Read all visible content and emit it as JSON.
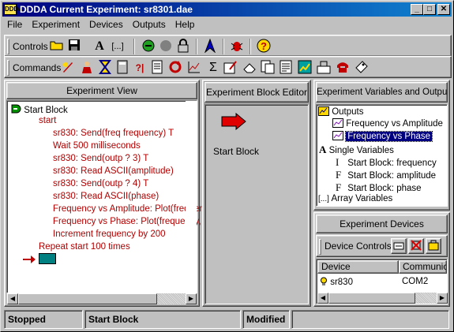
{
  "window": {
    "title": "DDDA Current Experiment: sr8301.dae",
    "app_icon": "DDDA",
    "minimize": "_",
    "maximize": "□",
    "close": "✕"
  },
  "menu": [
    "File",
    "Experiment",
    "Devices",
    "Outputs",
    "Help"
  ],
  "toolbar_controls": {
    "label": "Controls",
    "icons": [
      "open-folder-icon",
      "save-disk-icon",
      "font-a-icon",
      "ellipsis-brackets-icon",
      "green-run-icon",
      "gray-stop-icon",
      "lock-icon",
      "blue-arrow-icon",
      "bug-icon",
      "help-question-icon"
    ]
  },
  "toolbar_commands": {
    "label": "Commands",
    "icons": [
      "rocket-icon",
      "person-icon",
      "hourglass-icon",
      "calculator-icon",
      "conditional-icon",
      "file-icon",
      "loop-icon",
      "graph-icon",
      "sigma-icon",
      "write-icon",
      "eraser-icon",
      "report-icon",
      "document-icon",
      "chart-image-icon",
      "plot-icon",
      "phone-icon",
      "label-icon"
    ]
  },
  "experiment_view": {
    "header": "Experiment View",
    "lines": [
      {
        "text": "Start Block",
        "indent": 0,
        "red": false,
        "icon": true
      },
      {
        "text": "start",
        "indent": 1,
        "red": true
      },
      {
        "text": "sr830: Send(freq frequency) T",
        "indent": 2,
        "red": true
      },
      {
        "text": "Wait 500 milliseconds",
        "indent": 2,
        "red": true
      },
      {
        "text": "sr830: Send(outp ? 3) T",
        "indent": 2,
        "red": true
      },
      {
        "text": "sr830: Read ASCII(amplitude)",
        "indent": 2,
        "red": true
      },
      {
        "text": "sr830: Send(outp ? 4) T",
        "indent": 2,
        "red": true
      },
      {
        "text": "sr830: Read ASCII(phase)",
        "indent": 2,
        "red": true
      },
      {
        "text": "Frequency vs Amplitude: Plot(frequenc",
        "indent": 2,
        "red": true
      },
      {
        "text": "Frequency vs Phase: Plot(frequency, p",
        "indent": 2,
        "red": true
      },
      {
        "text": "Increment frequency by 200",
        "indent": 2,
        "red": true
      },
      {
        "text": "Repeat start 100 times",
        "indent": 1,
        "red": true
      }
    ]
  },
  "block_editor": {
    "header": "Experiment Block Editor",
    "block_label": "Start Block"
  },
  "variables": {
    "header": "Experiment Variables and Outputs",
    "outputs_label": "Outputs",
    "outputs": [
      "Frequency vs Amplitude",
      "Frequency vs Phase"
    ],
    "selected_output": "Frequency vs Phase",
    "single_label": "Single Variables",
    "singles": [
      "Start Block: frequency",
      "Start Block: amplitude",
      "Start Block: phase"
    ],
    "single_icons": [
      "I",
      "F",
      "F"
    ],
    "array_label": "Array Variables",
    "array_icon": "[...]",
    "outputs_icon": "A"
  },
  "devices": {
    "header": "Experiment Devices",
    "controls_label": "Device Controls",
    "columns": [
      "Device",
      "Communicat"
    ],
    "rows": [
      {
        "device": "sr830",
        "comm": "COM2"
      }
    ]
  },
  "status": {
    "state": "Stopped",
    "block": "Start Block",
    "modified": "Modified"
  }
}
